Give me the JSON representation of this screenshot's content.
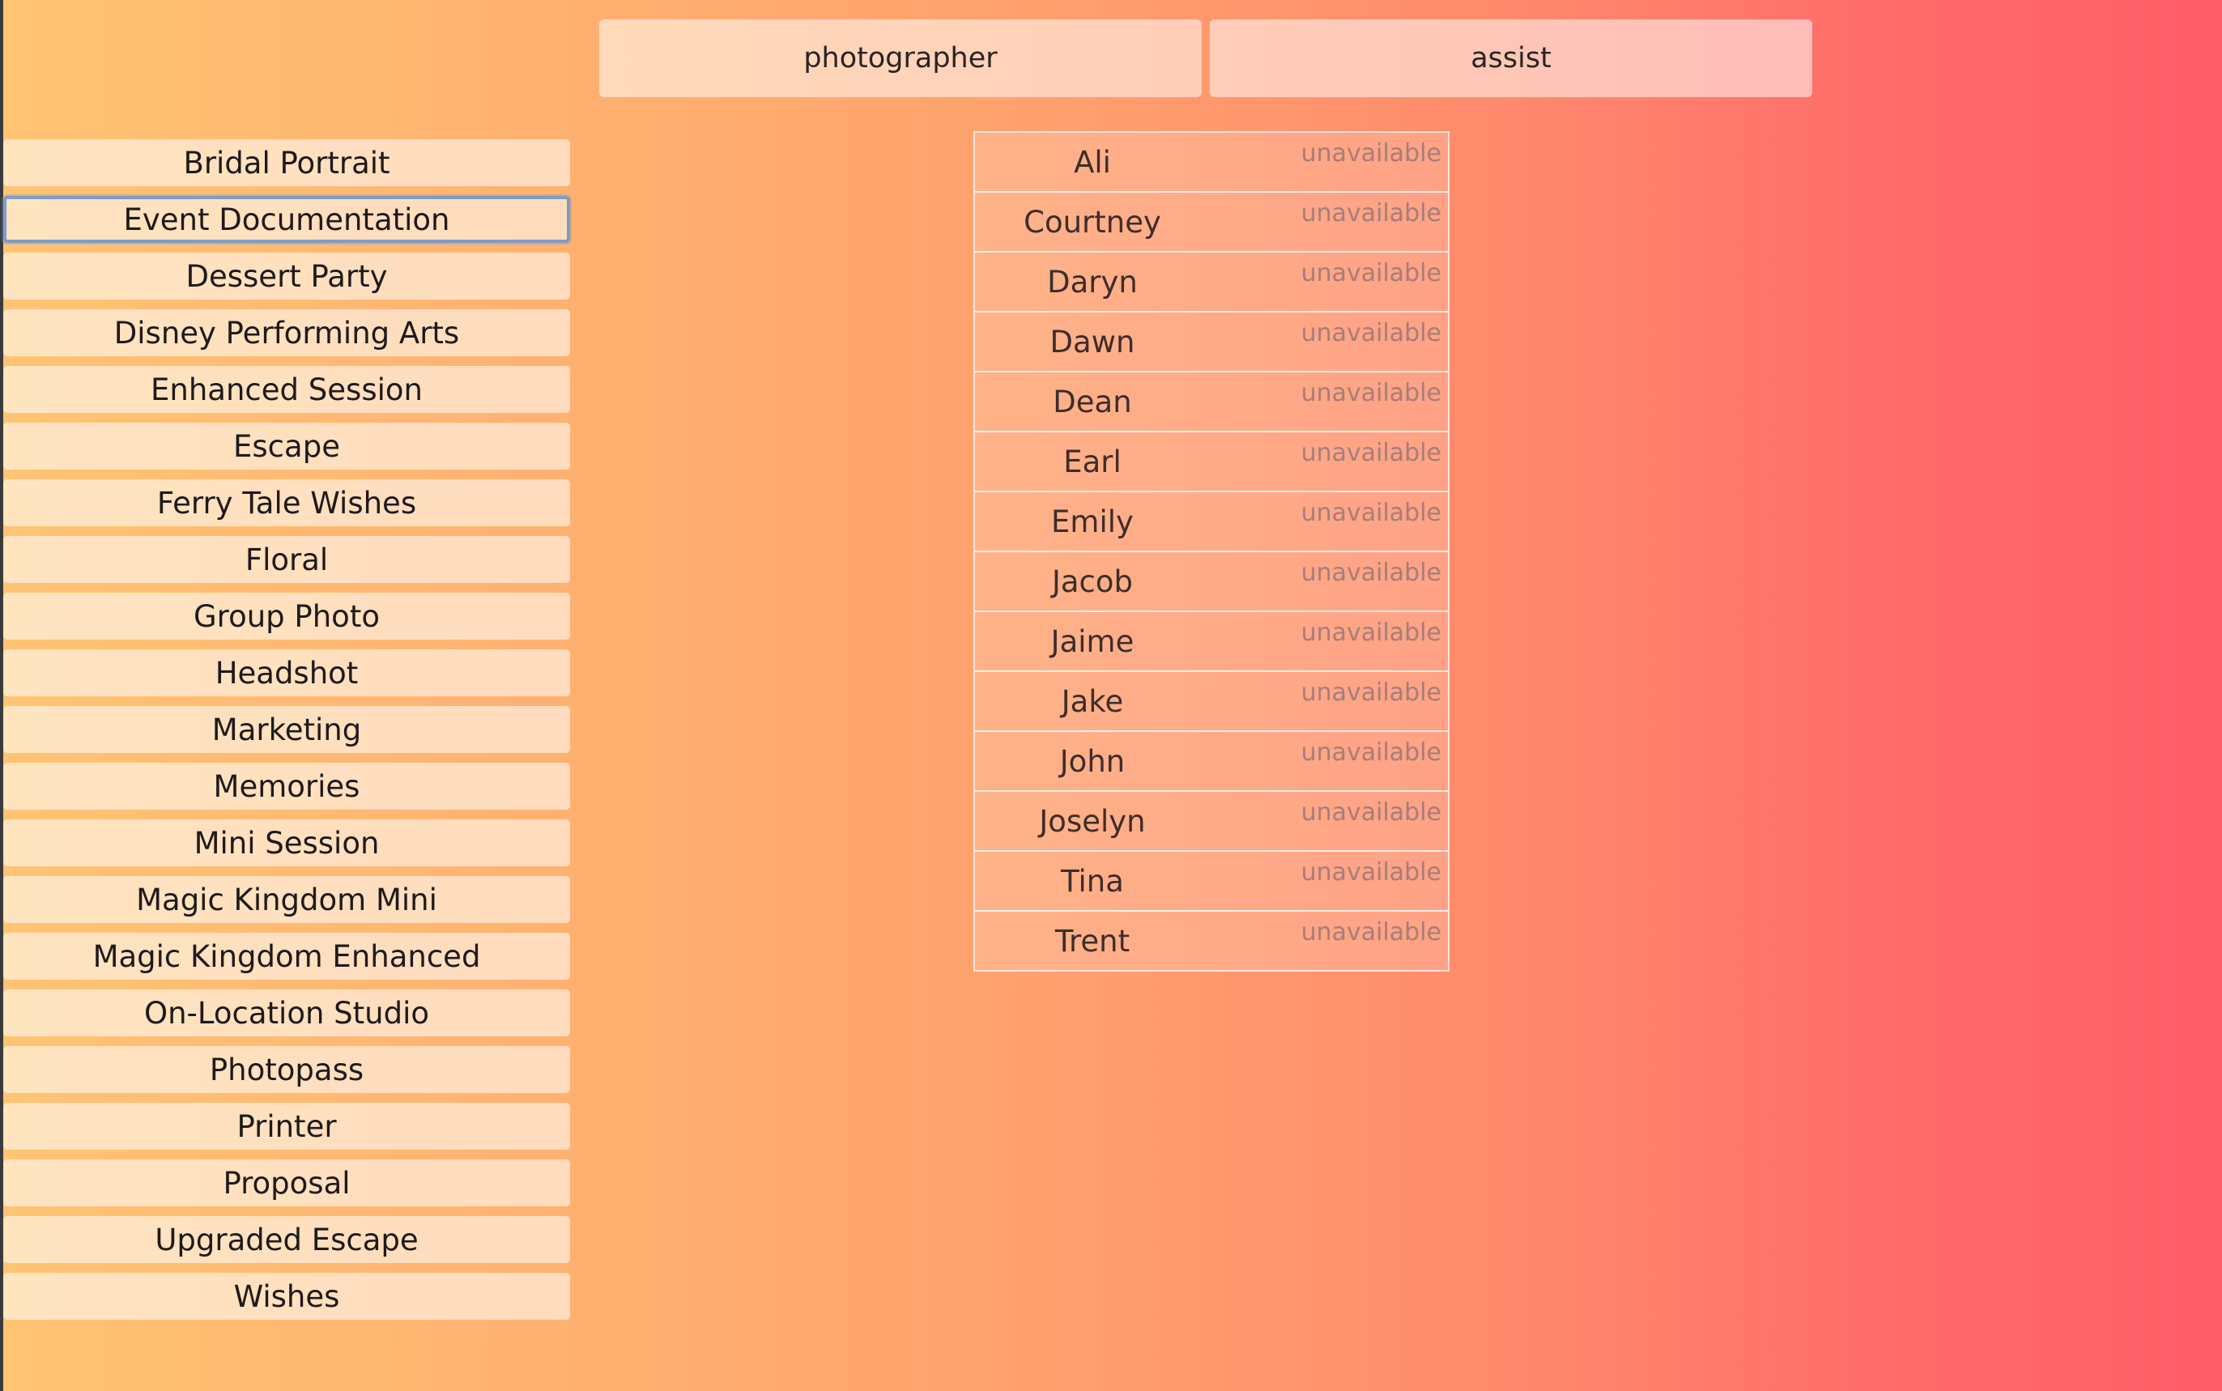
{
  "tabs": [
    {
      "label": "photographer"
    },
    {
      "label": "assist"
    }
  ],
  "services": [
    "Bridal Portrait",
    "Event Documentation",
    "Dessert Party",
    "Disney Performing Arts",
    "Enhanced Session",
    "Escape",
    "Ferry Tale Wishes",
    "Floral",
    "Group Photo",
    "Headshot",
    "Marketing",
    "Memories",
    "Mini Session",
    "Magic Kingdom Mini",
    "Magic Kingdom Enhanced",
    "On-Location Studio",
    "Photopass",
    "Printer",
    "Proposal",
    "Upgraded Escape",
    "Wishes"
  ],
  "focused_service": "Event Documentation",
  "staff": [
    {
      "name": "Ali",
      "status": "unavailable"
    },
    {
      "name": "Courtney",
      "status": "unavailable"
    },
    {
      "name": "Daryn",
      "status": "unavailable"
    },
    {
      "name": "Dawn",
      "status": "unavailable"
    },
    {
      "name": "Dean",
      "status": "unavailable"
    },
    {
      "name": "Earl",
      "status": "unavailable"
    },
    {
      "name": "Emily",
      "status": "unavailable"
    },
    {
      "name": "Jacob",
      "status": "unavailable"
    },
    {
      "name": "Jaime",
      "status": "unavailable"
    },
    {
      "name": "Jake",
      "status": "unavailable"
    },
    {
      "name": "John",
      "status": "unavailable"
    },
    {
      "name": "Joselyn",
      "status": "unavailable"
    },
    {
      "name": "Tina",
      "status": "unavailable"
    },
    {
      "name": "Trent",
      "status": "unavailable"
    }
  ]
}
